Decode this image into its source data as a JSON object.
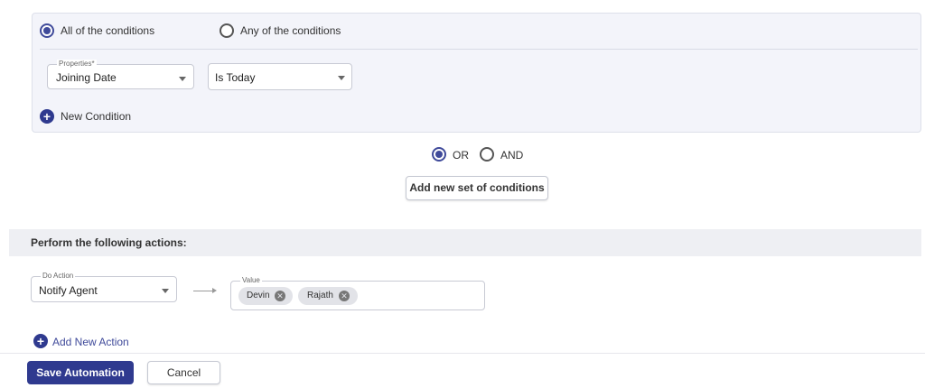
{
  "condition_group": {
    "match_options": [
      {
        "label": "All of the conditions",
        "selected": true
      },
      {
        "label": "Any of the conditions",
        "selected": false
      }
    ],
    "property_field": {
      "label": "Properties*",
      "value": "Joining Date"
    },
    "operator_field": {
      "value": "Is Today"
    },
    "new_condition_label": "New Condition"
  },
  "join_options": [
    {
      "label": "OR",
      "selected": true
    },
    {
      "label": "AND",
      "selected": false
    }
  ],
  "add_set_label": "Add new set of conditions",
  "actions": {
    "title": "Perform the following actions:",
    "do_action": {
      "label": "Do Action",
      "value": "Notify Agent"
    },
    "value_field": {
      "label": "Value",
      "chips": [
        "Devin",
        "Rajath"
      ]
    },
    "add_action_label": "Add New Action"
  },
  "footer": {
    "save_label": "Save Automation",
    "cancel_label": "Cancel"
  },
  "colors": {
    "accent": "#2f3a8f",
    "card_bg": "#f3f4fa",
    "section_bg": "#eeeff3"
  }
}
